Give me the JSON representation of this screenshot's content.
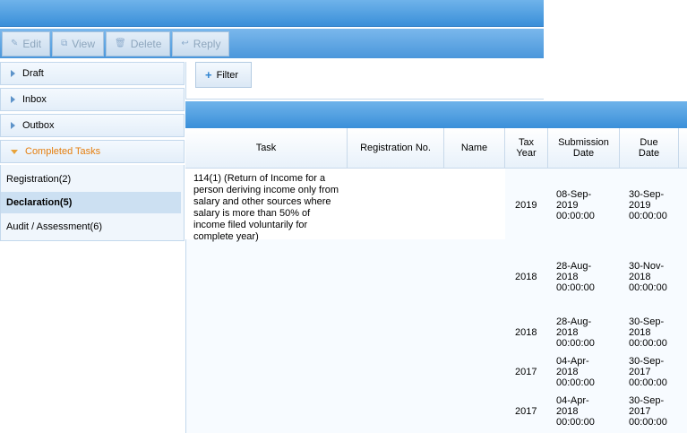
{
  "toolbar": {
    "buttons": [
      {
        "label": "Edit",
        "icon": "pencil-icon"
      },
      {
        "label": "View",
        "icon": "view-icon"
      },
      {
        "label": "Delete",
        "icon": "trash-icon"
      },
      {
        "label": "Reply",
        "icon": "reply-icon"
      }
    ]
  },
  "sidebar": {
    "nodes": [
      {
        "label": "Draft"
      },
      {
        "label": "Inbox"
      },
      {
        "label": "Outbox"
      },
      {
        "label": "Completed Tasks"
      }
    ],
    "subitems": [
      {
        "label": "Registration(2)"
      },
      {
        "label": "Declaration(5)"
      },
      {
        "label": "Audit / Assessment(6)"
      }
    ]
  },
  "filter": {
    "label": "Filter"
  },
  "table": {
    "columns": [
      "Task",
      "Registration No.",
      "Name",
      "Tax Year",
      "Submission Date",
      "Due Date"
    ],
    "task_text": "114(1) (Return of Income for a person deriving income only from salary and other sources where salary is more than 50% of income filed voluntarily for complete year)",
    "rows": [
      {
        "year": "2019",
        "submission": "08-Sep-2019 00:00:00",
        "due": "30-Sep-2019 00:00:00"
      },
      {
        "year": "2018",
        "submission": "28-Aug-2018 00:00:00",
        "due": "30-Nov-2018 00:00:00"
      },
      {
        "year": "2018",
        "submission": "28-Aug-2018 00:00:00",
        "due": "30-Sep-2018 00:00:00"
      },
      {
        "year": "2017",
        "submission": "04-Apr-2018 00:00:00",
        "due": "30-Sep-2017 00:00:00"
      },
      {
        "year": "2017",
        "submission": "04-Apr-2018 00:00:00",
        "due": "30-Sep-2017 00:00:00"
      }
    ]
  },
  "colors": {
    "header_blue": "#3a8fd9",
    "selected_row": "#cce0f2",
    "accent_orange": "#e57f0f"
  }
}
